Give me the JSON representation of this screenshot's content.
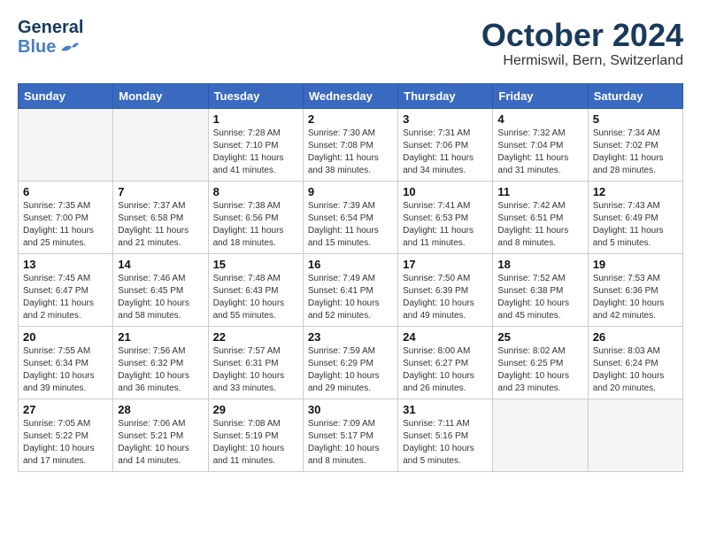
{
  "header": {
    "logo_general": "General",
    "logo_blue": "Blue",
    "month": "October 2024",
    "location": "Hermiswil, Bern, Switzerland"
  },
  "weekdays": [
    "Sunday",
    "Monday",
    "Tuesday",
    "Wednesday",
    "Thursday",
    "Friday",
    "Saturday"
  ],
  "weeks": [
    [
      {
        "day": "",
        "info": ""
      },
      {
        "day": "",
        "info": ""
      },
      {
        "day": "1",
        "info": "Sunrise: 7:28 AM\nSunset: 7:10 PM\nDaylight: 11 hours and 41 minutes."
      },
      {
        "day": "2",
        "info": "Sunrise: 7:30 AM\nSunset: 7:08 PM\nDaylight: 11 hours and 38 minutes."
      },
      {
        "day": "3",
        "info": "Sunrise: 7:31 AM\nSunset: 7:06 PM\nDaylight: 11 hours and 34 minutes."
      },
      {
        "day": "4",
        "info": "Sunrise: 7:32 AM\nSunset: 7:04 PM\nDaylight: 11 hours and 31 minutes."
      },
      {
        "day": "5",
        "info": "Sunrise: 7:34 AM\nSunset: 7:02 PM\nDaylight: 11 hours and 28 minutes."
      }
    ],
    [
      {
        "day": "6",
        "info": "Sunrise: 7:35 AM\nSunset: 7:00 PM\nDaylight: 11 hours and 25 minutes."
      },
      {
        "day": "7",
        "info": "Sunrise: 7:37 AM\nSunset: 6:58 PM\nDaylight: 11 hours and 21 minutes."
      },
      {
        "day": "8",
        "info": "Sunrise: 7:38 AM\nSunset: 6:56 PM\nDaylight: 11 hours and 18 minutes."
      },
      {
        "day": "9",
        "info": "Sunrise: 7:39 AM\nSunset: 6:54 PM\nDaylight: 11 hours and 15 minutes."
      },
      {
        "day": "10",
        "info": "Sunrise: 7:41 AM\nSunset: 6:53 PM\nDaylight: 11 hours and 11 minutes."
      },
      {
        "day": "11",
        "info": "Sunrise: 7:42 AM\nSunset: 6:51 PM\nDaylight: 11 hours and 8 minutes."
      },
      {
        "day": "12",
        "info": "Sunrise: 7:43 AM\nSunset: 6:49 PM\nDaylight: 11 hours and 5 minutes."
      }
    ],
    [
      {
        "day": "13",
        "info": "Sunrise: 7:45 AM\nSunset: 6:47 PM\nDaylight: 11 hours and 2 minutes."
      },
      {
        "day": "14",
        "info": "Sunrise: 7:46 AM\nSunset: 6:45 PM\nDaylight: 10 hours and 58 minutes."
      },
      {
        "day": "15",
        "info": "Sunrise: 7:48 AM\nSunset: 6:43 PM\nDaylight: 10 hours and 55 minutes."
      },
      {
        "day": "16",
        "info": "Sunrise: 7:49 AM\nSunset: 6:41 PM\nDaylight: 10 hours and 52 minutes."
      },
      {
        "day": "17",
        "info": "Sunrise: 7:50 AM\nSunset: 6:39 PM\nDaylight: 10 hours and 49 minutes."
      },
      {
        "day": "18",
        "info": "Sunrise: 7:52 AM\nSunset: 6:38 PM\nDaylight: 10 hours and 45 minutes."
      },
      {
        "day": "19",
        "info": "Sunrise: 7:53 AM\nSunset: 6:36 PM\nDaylight: 10 hours and 42 minutes."
      }
    ],
    [
      {
        "day": "20",
        "info": "Sunrise: 7:55 AM\nSunset: 6:34 PM\nDaylight: 10 hours and 39 minutes."
      },
      {
        "day": "21",
        "info": "Sunrise: 7:56 AM\nSunset: 6:32 PM\nDaylight: 10 hours and 36 minutes."
      },
      {
        "day": "22",
        "info": "Sunrise: 7:57 AM\nSunset: 6:31 PM\nDaylight: 10 hours and 33 minutes."
      },
      {
        "day": "23",
        "info": "Sunrise: 7:59 AM\nSunset: 6:29 PM\nDaylight: 10 hours and 29 minutes."
      },
      {
        "day": "24",
        "info": "Sunrise: 8:00 AM\nSunset: 6:27 PM\nDaylight: 10 hours and 26 minutes."
      },
      {
        "day": "25",
        "info": "Sunrise: 8:02 AM\nSunset: 6:25 PM\nDaylight: 10 hours and 23 minutes."
      },
      {
        "day": "26",
        "info": "Sunrise: 8:03 AM\nSunset: 6:24 PM\nDaylight: 10 hours and 20 minutes."
      }
    ],
    [
      {
        "day": "27",
        "info": "Sunrise: 7:05 AM\nSunset: 5:22 PM\nDaylight: 10 hours and 17 minutes."
      },
      {
        "day": "28",
        "info": "Sunrise: 7:06 AM\nSunset: 5:21 PM\nDaylight: 10 hours and 14 minutes."
      },
      {
        "day": "29",
        "info": "Sunrise: 7:08 AM\nSunset: 5:19 PM\nDaylight: 10 hours and 11 minutes."
      },
      {
        "day": "30",
        "info": "Sunrise: 7:09 AM\nSunset: 5:17 PM\nDaylight: 10 hours and 8 minutes."
      },
      {
        "day": "31",
        "info": "Sunrise: 7:11 AM\nSunset: 5:16 PM\nDaylight: 10 hours and 5 minutes."
      },
      {
        "day": "",
        "info": ""
      },
      {
        "day": "",
        "info": ""
      }
    ]
  ]
}
